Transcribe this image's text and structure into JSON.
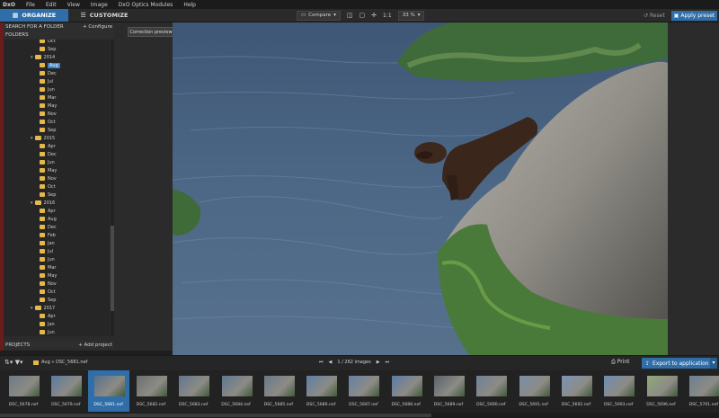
{
  "app": {
    "logo": "DxO",
    "menu": [
      "File",
      "Edit",
      "View",
      "Image",
      "DxO Optics Modules",
      "Help"
    ]
  },
  "tabs": {
    "organize": "ORGANIZE",
    "customize": "CUSTOMIZE"
  },
  "toolbar": {
    "compare": "Compare",
    "one_to_one": "1:1",
    "zoom": "33 %",
    "reset": "Reset",
    "apply_preset": "Apply preset"
  },
  "tooltip": "Correction preview",
  "left_panel": {
    "search_title": "SEARCH FOR A FOLDER",
    "configure": "+ Configure",
    "folders_title": "FOLDERS",
    "projects_title": "PROJECTS",
    "add_project": "+ Add project",
    "tree": [
      {
        "label": "Oct",
        "level": 2
      },
      {
        "label": "Sep",
        "level": 2
      },
      {
        "label": "2014",
        "level": 1,
        "year": true
      },
      {
        "label": "Aug",
        "level": 2,
        "selected": true
      },
      {
        "label": "Dec",
        "level": 2
      },
      {
        "label": "Jul",
        "level": 2
      },
      {
        "label": "Jun",
        "level": 2
      },
      {
        "label": "Mar",
        "level": 2
      },
      {
        "label": "May",
        "level": 2
      },
      {
        "label": "Nov",
        "level": 2
      },
      {
        "label": "Oct",
        "level": 2
      },
      {
        "label": "Sep",
        "level": 2
      },
      {
        "label": "2015",
        "level": 1,
        "year": true
      },
      {
        "label": "Apr",
        "level": 2
      },
      {
        "label": "Dec",
        "level": 2
      },
      {
        "label": "Jun",
        "level": 2
      },
      {
        "label": "May",
        "level": 2
      },
      {
        "label": "Nov",
        "level": 2
      },
      {
        "label": "Oct",
        "level": 2
      },
      {
        "label": "Sep",
        "level": 2
      },
      {
        "label": "2016",
        "level": 1,
        "year": true
      },
      {
        "label": "Apr",
        "level": 2
      },
      {
        "label": "Aug",
        "level": 2
      },
      {
        "label": "Dec",
        "level": 2
      },
      {
        "label": "Feb",
        "level": 2
      },
      {
        "label": "Jan",
        "level": 2
      },
      {
        "label": "Jul",
        "level": 2
      },
      {
        "label": "Jun",
        "level": 2
      },
      {
        "label": "Mar",
        "level": 2
      },
      {
        "label": "May",
        "level": 2
      },
      {
        "label": "Nov",
        "level": 2
      },
      {
        "label": "Oct",
        "level": 2
      },
      {
        "label": "Sep",
        "level": 2
      },
      {
        "label": "2017",
        "level": 1,
        "year": true
      },
      {
        "label": "Apr",
        "level": 2
      },
      {
        "label": "Jan",
        "level": 2
      },
      {
        "label": "Jun",
        "level": 2
      },
      {
        "label": "Mar",
        "level": 2
      }
    ]
  },
  "status_bar": {
    "breadcrumb": "Aug » DSC_5681.nef",
    "image_count": "1 / 262 images",
    "print": "Print",
    "export": "Export to application"
  },
  "filmstrip": [
    {
      "name": "DSC_5678.nef",
      "tone": "#6c7a86"
    },
    {
      "name": "DSC_5679.nef",
      "tone": "#5a7aa0"
    },
    {
      "name": "DSC_5681.nef",
      "tone": "#58708c",
      "selected": true
    },
    {
      "name": "DSC_5682.nef",
      "tone": "#6b6f70"
    },
    {
      "name": "DSC_5683.nef",
      "tone": "#61768e"
    },
    {
      "name": "DSC_5684.nef",
      "tone": "#5e7892"
    },
    {
      "name": "DSC_5685.nef",
      "tone": "#69798a"
    },
    {
      "name": "DSC_5686.nef",
      "tone": "#5c7ea5"
    },
    {
      "name": "DSC_5687.nef",
      "tone": "#6482a6"
    },
    {
      "name": "DSC_5688.nef",
      "tone": "#5b7ba3"
    },
    {
      "name": "DSC_5689.nef",
      "tone": "#58626a"
    },
    {
      "name": "DSC_5690.nef",
      "tone": "#6f8196"
    },
    {
      "name": "DSC_5691.nef",
      "tone": "#7a8fa6"
    },
    {
      "name": "DSC_5692.nef",
      "tone": "#7a95b6"
    },
    {
      "name": "DSC_5693.nef",
      "tone": "#6d8db4"
    },
    {
      "name": "DSC_5696.nef",
      "tone": "#8fa978"
    },
    {
      "name": "DSC_5701.nef",
      "tone": "#6b7f90"
    }
  ],
  "colors": {
    "accent": "#2f6ea8",
    "folder": "#e3b94a"
  }
}
